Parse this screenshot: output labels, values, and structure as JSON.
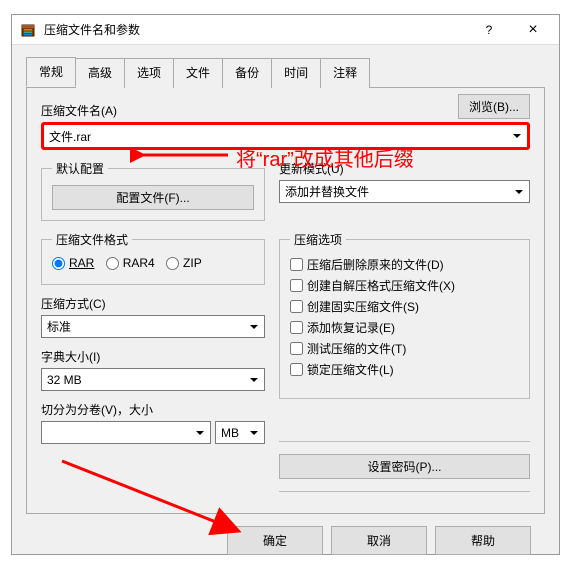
{
  "window": {
    "title": "压缩文件名和参数",
    "help": "?",
    "close": "×"
  },
  "tabs": [
    "常规",
    "高级",
    "选项",
    "文件",
    "备份",
    "时间",
    "注释"
  ],
  "browse": "浏览(B)...",
  "filename": {
    "label": "压缩文件名(A)",
    "value": "文件.rar"
  },
  "defaultProfile": {
    "legend": "默认配置",
    "button": "配置文件(F)..."
  },
  "updateMode": {
    "label": "更新模式(U)",
    "value": "添加并替换文件"
  },
  "format": {
    "legend": "压缩文件格式",
    "options": [
      "RAR",
      "RAR4",
      "ZIP"
    ]
  },
  "options": {
    "legend": "压缩选项",
    "items": [
      "压缩后删除原来的文件(D)",
      "创建自解压格式压缩文件(X)",
      "创建固实压缩文件(S)",
      "添加恢复记录(E)",
      "测试压缩的文件(T)",
      "锁定压缩文件(L)"
    ]
  },
  "method": {
    "label": "压缩方式(C)",
    "value": "标准"
  },
  "dict": {
    "label": "字典大小(I)",
    "value": "32 MB"
  },
  "split": {
    "label": "切分为分卷(V)，大小",
    "unit": "MB",
    "value": ""
  },
  "password": "设置密码(P)...",
  "buttons": {
    "ok": "确定",
    "cancel": "取消",
    "help": "帮助"
  },
  "annotation": "将“rar”改成其他后缀"
}
